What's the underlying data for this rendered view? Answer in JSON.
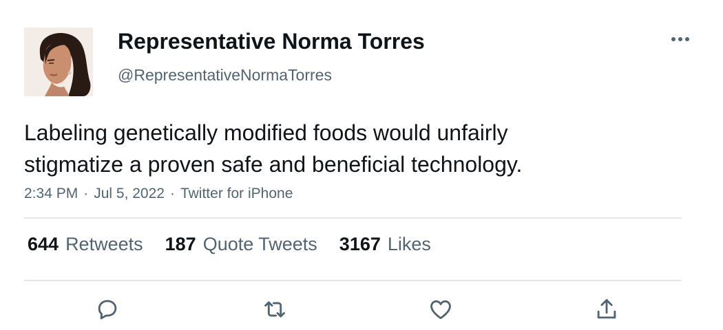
{
  "author": {
    "display_name": "Representative Norma Torres",
    "handle": "@RepresentativeNormaTorres",
    "avatar_icon": "profile-photo"
  },
  "tweet": {
    "text": "Labeling genetically modified foods would unfairly\nstigmatize a proven safe and beneficial technology.",
    "time": "2:34 PM",
    "date": "Jul 5, 2022",
    "source": "Twitter for iPhone",
    "separator": "·"
  },
  "stats": {
    "retweets_count": "644",
    "retweets_label": "Retweets",
    "quotes_count": "187",
    "quotes_label": "Quote Tweets",
    "likes_count": "3167",
    "likes_label": "Likes"
  },
  "actions": [
    "reply-icon",
    "retweet-icon",
    "like-icon",
    "share-icon"
  ],
  "colors": {
    "text_primary": "#0f1419",
    "text_secondary": "#536471",
    "divider": "#e3e7ea"
  }
}
